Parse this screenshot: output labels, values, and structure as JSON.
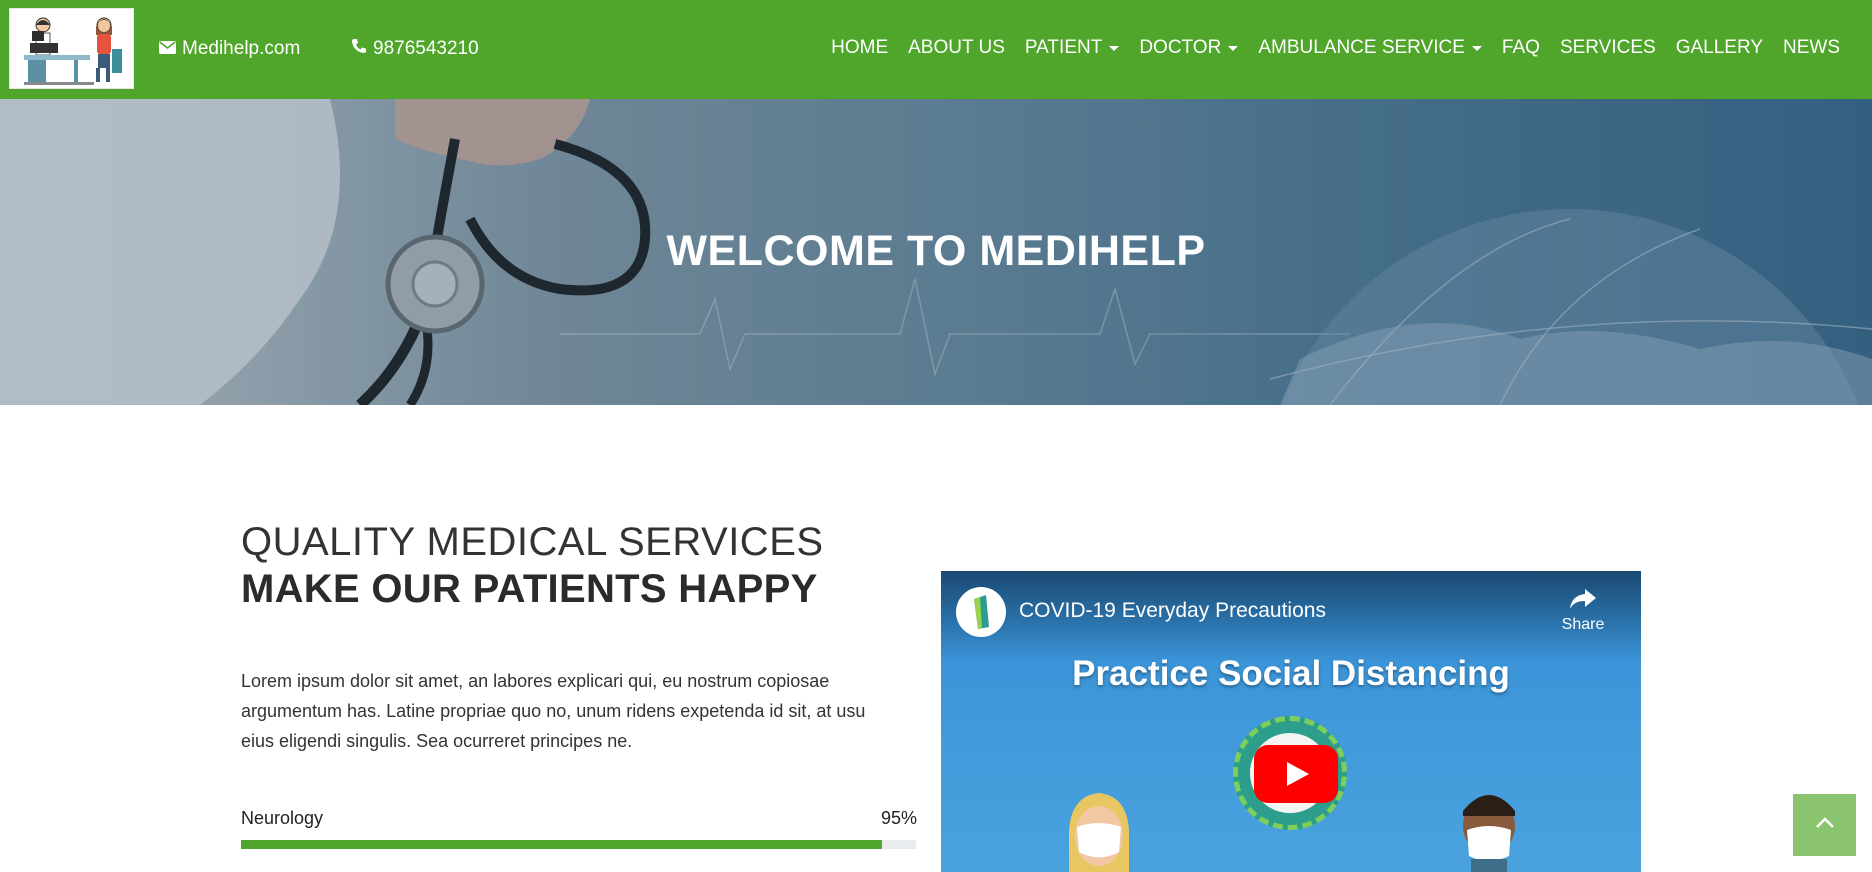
{
  "header": {
    "email": "Medihelp.com",
    "phone": "9876543210",
    "nav": [
      {
        "label": "HOME",
        "dropdown": false
      },
      {
        "label": "ABOUT US",
        "dropdown": false
      },
      {
        "label": "PATIENT",
        "dropdown": true
      },
      {
        "label": "DOCTOR",
        "dropdown": true
      },
      {
        "label": "AMBULANCE SERVICE",
        "dropdown": true
      },
      {
        "label": "FAQ",
        "dropdown": false
      },
      {
        "label": "SERVICES",
        "dropdown": false
      },
      {
        "label": "GALLERY",
        "dropdown": false
      },
      {
        "label": "NEWS",
        "dropdown": false
      }
    ]
  },
  "hero": {
    "title": "WELCOME TO MEDIHELP"
  },
  "about": {
    "subtitle": "QUALITY MEDICAL SERVICES",
    "heading": "MAKE OUR PATIENTS HAPPY",
    "paragraph": "Lorem ipsum dolor sit amet, an labores explicari qui, eu nostrum copiosae argumentum has. Latine propriae quo no, unum ridens expetenda id sit, at usu eius eligendi singulis. Sea ocurreret principes ne."
  },
  "skills": [
    {
      "label": "Neurology",
      "value_text": "95%",
      "percent": 95
    }
  ],
  "video": {
    "title": "COVID-19 Everyday Precautions",
    "share_label": "Share",
    "headline": "Practice Social Distancing"
  },
  "colors": {
    "brand_green": "#4fa62b",
    "back_to_top": "#8ac46f",
    "youtube_red": "#ff0000"
  },
  "icons": {
    "email": "envelope-icon",
    "phone": "phone-icon",
    "share": "share-arrow-icon",
    "back_to_top": "chevron-up-icon"
  }
}
